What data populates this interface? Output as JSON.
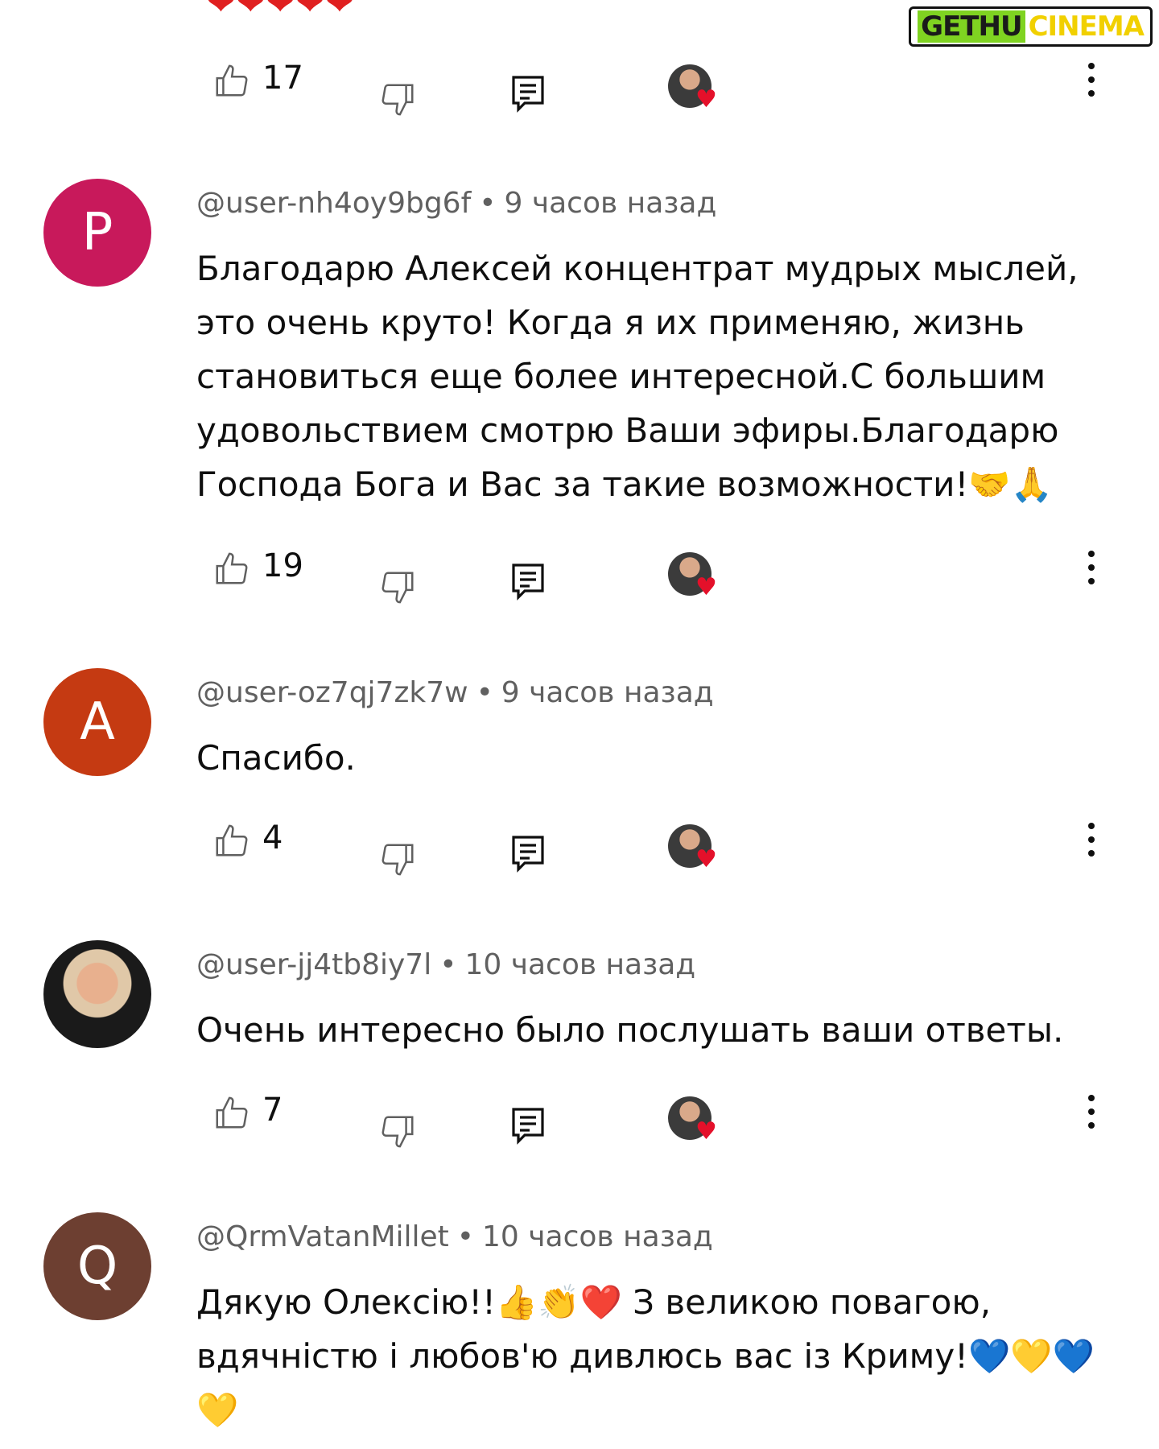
{
  "watermark": {
    "part1": "GETHU",
    "part2": "CINEMA"
  },
  "top_hearts": "❤❤❤❤❤",
  "first_actions": {
    "likes": "17"
  },
  "comments": [
    {
      "avatar_letter": "P",
      "avatar_color": "#c8195b",
      "author": "@user-nh4oy9bg6f",
      "time": "9 часов назад",
      "text": "Благодарю Алексей концентрат мудрых мыслей, это очень круто! Когда я их применяю, жизнь становиться еще более интересной.С большим удовольствием смотрю Ваши эфиры.Благодарю Господа Бога и Вас за такие возможности!🤝🙏",
      "likes": "19"
    },
    {
      "avatar_letter": "A",
      "avatar_color": "#c53a12",
      "author": "@user-oz7qj7zk7w",
      "time": "9 часов назад",
      "text": "Спасибо.",
      "likes": "4"
    },
    {
      "avatar_letter": "",
      "author": "@user-jj4tb8iy7l",
      "time": "10 часов назад",
      "text": "Очень интересно было послушать ваши ответы.",
      "likes": "7"
    },
    {
      "avatar_letter": "Q",
      "avatar_color": "#6d3f31",
      "author": "@QrmVatanMillet",
      "time": "10 часов назад",
      "text": "Дякую Олексію!!👍👏❤️ З великою повагою, вдячністю і любов'ю дивлюсь вас із Криму!💙💛💙💛"
    }
  ]
}
